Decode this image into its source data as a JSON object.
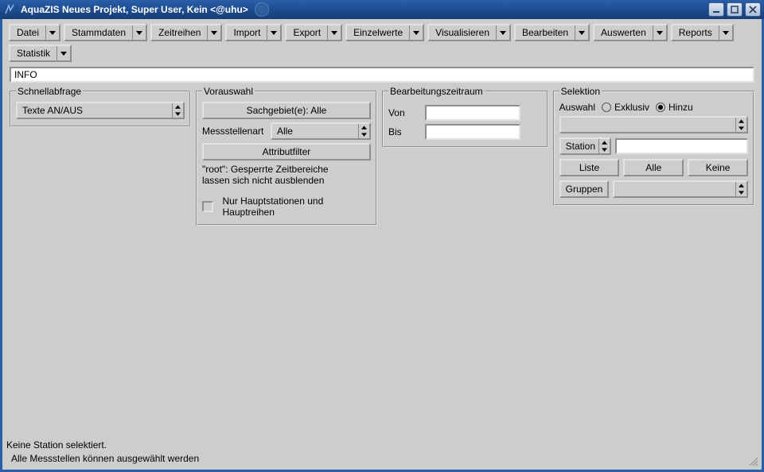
{
  "window": {
    "title": "AquaZIS Neues Projekt, Super User, Kein <@uhu>"
  },
  "menubar": {
    "items": [
      "Datei",
      "Stammdaten",
      "Zeitreihen",
      "Import",
      "Export",
      "Einzelwerte",
      "Visualisieren",
      "Bearbeiten",
      "Auswerten",
      "Reports",
      "Statistik"
    ]
  },
  "info": {
    "value": "INFO"
  },
  "schnellabfrage": {
    "legend": "Schnellabfrage",
    "combo_value": "Texte AN/AUS"
  },
  "vorauswahl": {
    "legend": "Vorauswahl",
    "sachgebiet_btn": "Sachgebiet(e): Alle",
    "messstellenart_label": "Messstellenart",
    "messstellenart_value": "Alle",
    "attributfilter_btn": "Attributfilter",
    "note_line1": "\"root\": Gesperrte Zeitbereiche",
    "note_line2": "lassen sich nicht ausblenden",
    "checkbox_label": "Nur Hauptstationen und Hauptreihen"
  },
  "bearbeitungszeitraum": {
    "legend": "Bearbeitungszeitraum",
    "von_label": "Von",
    "bis_label": "Bis",
    "von_value": "",
    "bis_value": ""
  },
  "selektion": {
    "legend": "Selektion",
    "auswahl_label": "Auswahl",
    "exklusiv_label": "Exklusiv",
    "hinzu_label": "Hinzu",
    "selected_mode": "hinzu",
    "combo1_value": "",
    "station_btn": "Station",
    "station_field": "",
    "liste_btn": "Liste",
    "alle_btn": "Alle",
    "keine_btn": "Keine",
    "gruppen_btn": "Gruppen",
    "gruppen_combo": ""
  },
  "status": {
    "line1": "Keine Station selektiert.",
    "line2": "Alle Messstellen können ausgewählt werden"
  }
}
